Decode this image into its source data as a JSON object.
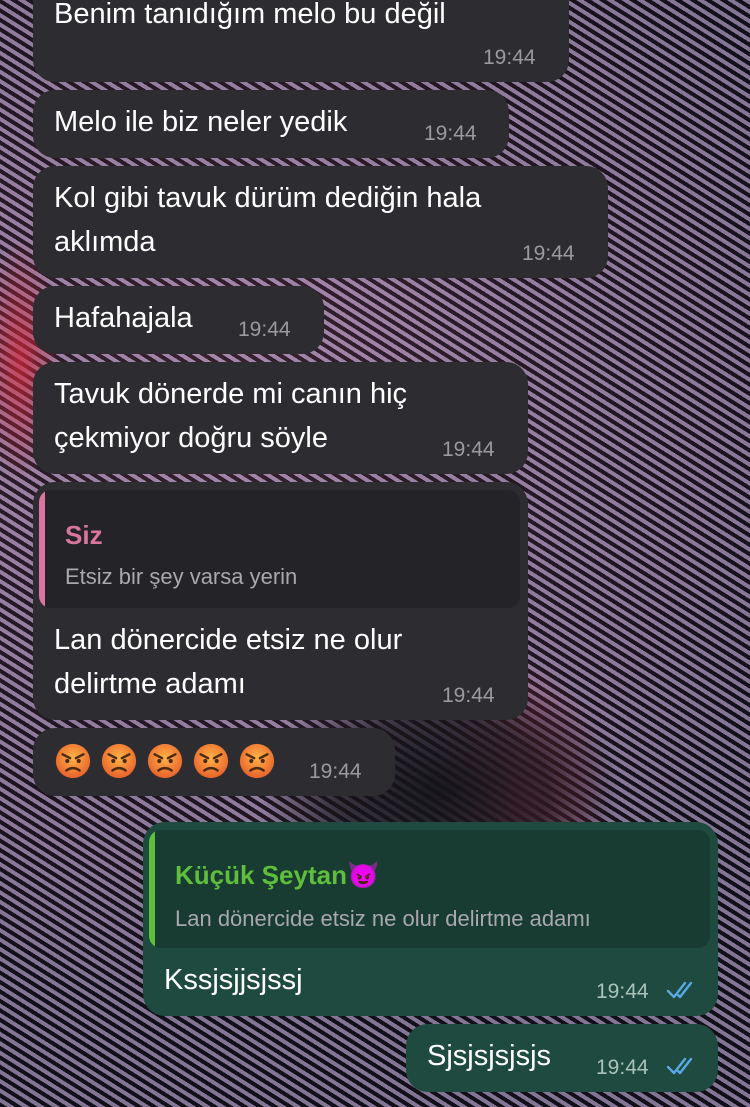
{
  "colors": {
    "incoming_bubble": "#2d2c30",
    "outgoing_bubble": "#1f4a3f",
    "reply_pink": "#d9759e",
    "reply_green": "#5fbf3c",
    "read_checks": "#5aa9e6"
  },
  "messages": [
    {
      "text": "Benim tanıdığım melo bu değil",
      "time": "19:44"
    },
    {
      "text": "Melo ile biz neler yedik",
      "time": "19:44"
    },
    {
      "text": "Kol gibi tavuk dürüm dediğin hala\naklımda",
      "time": "19:44"
    },
    {
      "text": "Hafahajala",
      "time": "19:44"
    },
    {
      "text": "Tavuk dönerde mi canın hiç\nçekmiyor doğru söyle",
      "time": "19:44"
    },
    {
      "reply": {
        "name": "Siz",
        "text": "Etsiz bir şey varsa yerin"
      },
      "text": "Lan dönercide etsiz ne olur\ndelirtme adamı",
      "time": "19:44"
    },
    {
      "emoji": [
        "angry-face",
        "angry-face",
        "angry-face",
        "angry-face",
        "angry-face"
      ],
      "time": "19:44"
    }
  ],
  "outgoing": [
    {
      "reply": {
        "name": "Küçük Şeytan😈",
        "text": "Lan dönercide etsiz ne olur delirtme adamı"
      },
      "text": "Kssjsjjsjssj",
      "time": "19:44",
      "status": "read-double-check-icon"
    },
    {
      "text": "Sjsjsjsjsjs",
      "time": "19:44",
      "status": "read-double-check-icon"
    }
  ]
}
